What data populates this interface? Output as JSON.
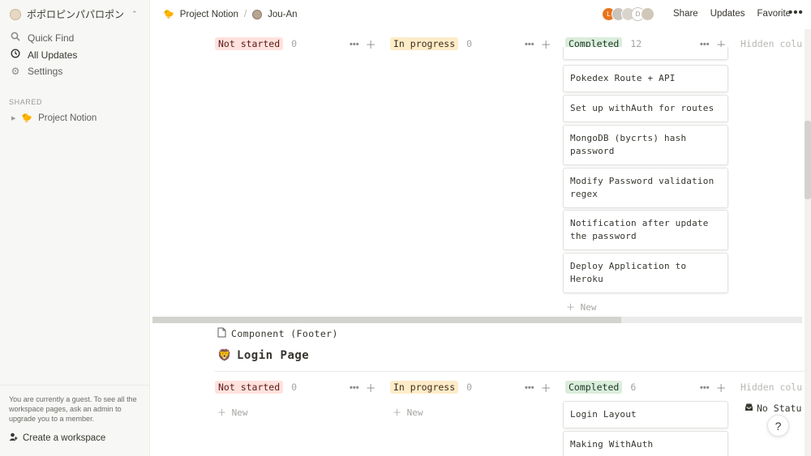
{
  "workspace": {
    "name": "ポポロピンパパロポン",
    "switch_icon": "chevron-up-down-icon"
  },
  "sidebar": {
    "nav": [
      {
        "label": "Quick Find",
        "icon": "search-icon"
      },
      {
        "label": "All Updates",
        "icon": "clock-icon"
      },
      {
        "label": "Settings",
        "icon": "gear-icon"
      }
    ],
    "shared_label": "SHARED",
    "shared_pages": [
      {
        "label": "Project Notion",
        "icon": "duck-emoji-icon"
      }
    ],
    "guest_note": "You are currently a guest. To see all the workspace pages, ask an admin to upgrade you to a member.",
    "create_label": "Create a workspace"
  },
  "topbar": {
    "breadcrumb": [
      "Project Notion",
      "Jou-An"
    ],
    "avatar_initials": [
      "L",
      "",
      "",
      "D",
      ""
    ],
    "actions": [
      "Share",
      "Updates",
      "Favorite"
    ],
    "more": "•••"
  },
  "board1": {
    "columns": [
      {
        "status": "Not started",
        "count": "0"
      },
      {
        "status": "In progress",
        "count": "0"
      },
      {
        "status": "Completed",
        "count": "12"
      }
    ],
    "hidden_label": "Hidden colu",
    "cards": [
      "Pokedex Route + API",
      "Set up withAuth for routes",
      "MongoDB (bycrts) hash password",
      "Modify Password validation regex",
      "Notification after update the password",
      "Deploy Application to Heroku"
    ],
    "new_label": "New"
  },
  "sub_item": {
    "label": "Component (Footer)",
    "icon": "page-icon"
  },
  "board2": {
    "title": "Login Page",
    "title_icon": "lion-emoji-icon",
    "columns": [
      {
        "status": "Not started",
        "count": "0"
      },
      {
        "status": "In progress",
        "count": "0"
      },
      {
        "status": "Completed",
        "count": "6"
      }
    ],
    "hidden_label": "Hidden colu",
    "no_status": "No Statu",
    "cards": [
      "Login Layout",
      "Making WithAuth"
    ],
    "new_label": "New"
  },
  "help_label": "?",
  "colors": {
    "not_started": "#ffe2dd",
    "in_progress": "#fdecc8",
    "completed": "#dbeddb"
  }
}
